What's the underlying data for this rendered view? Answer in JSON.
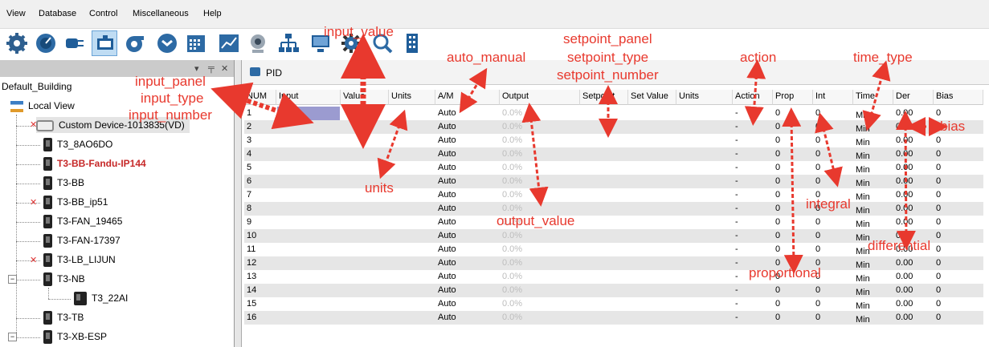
{
  "menu": [
    "View",
    "Database",
    "Control",
    "Miscellaneous",
    "Help"
  ],
  "toolbar_icons": [
    "gear-icon",
    "dial-icon",
    "plug-icon",
    "network-icon",
    "pump-icon",
    "clock-icon",
    "calendar-icon",
    "chart-icon",
    "camera-icon",
    "hierarchy-icon",
    "monitor-icon",
    "settings-icon",
    "search-icon",
    "building-icon"
  ],
  "tree": {
    "root": "Default_Building",
    "local_view": "Local View",
    "items": [
      {
        "label": "Custom Device-1013835(VD)"
      },
      {
        "label": "T3_8AO6DO"
      },
      {
        "label": "T3-BB-Fandu-IP144"
      },
      {
        "label": "T3-BB"
      },
      {
        "label": "T3-BB_ip51"
      },
      {
        "label": "T3-FAN_19465"
      },
      {
        "label": "T3-FAN-17397"
      },
      {
        "label": "T3-LB_LIJUN"
      },
      {
        "label": "T3-NB"
      },
      {
        "label": "T3_22AI"
      },
      {
        "label": "T3-TB"
      },
      {
        "label": "T3-XB-ESP"
      }
    ]
  },
  "tab": {
    "label": "PID"
  },
  "grid": {
    "headers": [
      "NUM",
      "Input",
      "Value",
      "Units",
      "A/M",
      "Output",
      "Setpoint",
      "Set Value",
      "Units",
      "Action",
      "Prop",
      "Int",
      "Time",
      "Der",
      "Bias"
    ],
    "rows": [
      [
        "1",
        "",
        "",
        "",
        "Auto",
        "0.0%",
        "",
        "",
        "",
        "-",
        "0",
        "0",
        "Min",
        "0.00",
        "0"
      ],
      [
        "2",
        "",
        "",
        "",
        "Auto",
        "0.0%",
        "",
        "",
        "",
        "-",
        "0",
        "0",
        "Min",
        "0.00",
        "0"
      ],
      [
        "3",
        "",
        "",
        "",
        "Auto",
        "0.0%",
        "",
        "",
        "",
        "-",
        "0",
        "0",
        "Min",
        "0.00",
        "0"
      ],
      [
        "4",
        "",
        "",
        "",
        "Auto",
        "0.0%",
        "",
        "",
        "",
        "-",
        "0",
        "0",
        "Min",
        "0.00",
        "0"
      ],
      [
        "5",
        "",
        "",
        "",
        "Auto",
        "0.0%",
        "",
        "",
        "",
        "-",
        "0",
        "0",
        "Min",
        "0.00",
        "0"
      ],
      [
        "6",
        "",
        "",
        "",
        "Auto",
        "0.0%",
        "",
        "",
        "",
        "-",
        "0",
        "0",
        "Min",
        "0.00",
        "0"
      ],
      [
        "7",
        "",
        "",
        "",
        "Auto",
        "0.0%",
        "",
        "",
        "",
        "-",
        "0",
        "0",
        "Min",
        "0.00",
        "0"
      ],
      [
        "8",
        "",
        "",
        "",
        "Auto",
        "0.0%",
        "",
        "",
        "",
        "-",
        "0",
        "0",
        "Min",
        "0.00",
        "0"
      ],
      [
        "9",
        "",
        "",
        "",
        "Auto",
        "0.0%",
        "",
        "",
        "",
        "-",
        "0",
        "0",
        "Min",
        "0.00",
        "0"
      ],
      [
        "10",
        "",
        "",
        "",
        "Auto",
        "0.0%",
        "",
        "",
        "",
        "-",
        "0",
        "0",
        "Min",
        "0.00",
        "0"
      ],
      [
        "11",
        "",
        "",
        "",
        "Auto",
        "0.0%",
        "",
        "",
        "",
        "-",
        "0",
        "0",
        "Min",
        "0.00",
        "0"
      ],
      [
        "12",
        "",
        "",
        "",
        "Auto",
        "0.0%",
        "",
        "",
        "",
        "-",
        "0",
        "0",
        "Min",
        "0.00",
        "0"
      ],
      [
        "13",
        "",
        "",
        "",
        "Auto",
        "0.0%",
        "",
        "",
        "",
        "-",
        "0",
        "0",
        "Min",
        "0.00",
        "0"
      ],
      [
        "14",
        "",
        "",
        "",
        "Auto",
        "0.0%",
        "",
        "",
        "",
        "-",
        "0",
        "0",
        "Min",
        "0.00",
        "0"
      ],
      [
        "15",
        "",
        "",
        "",
        "Auto",
        "0.0%",
        "",
        "",
        "",
        "-",
        "0",
        "0",
        "Min",
        "0.00",
        "0"
      ],
      [
        "16",
        "",
        "",
        "",
        "Auto",
        "0.0%",
        "",
        "",
        "",
        "-",
        "0",
        "0",
        "Min",
        "0.00",
        "0"
      ]
    ]
  },
  "annotations": {
    "input_value": "input_value",
    "input_panel": "input_panel",
    "input_type": "input_type",
    "input_number": "input_number",
    "auto_manual": "auto_manual",
    "setpoint_panel": "setpoint_panel",
    "setpoint_type": "setpoint_type",
    "setpoint_number": "setpoint_number",
    "action": "action",
    "time_type": "time_type",
    "units": "units",
    "output_value": "output_value",
    "integral": "integral",
    "bias": "bias",
    "differential": "differential",
    "proportional": "proportional"
  },
  "colors": {
    "annotation": "#e8392e",
    "selection": "#9b9bd0",
    "alt_row": "#e6e6e6",
    "red_device": "#c62828"
  }
}
